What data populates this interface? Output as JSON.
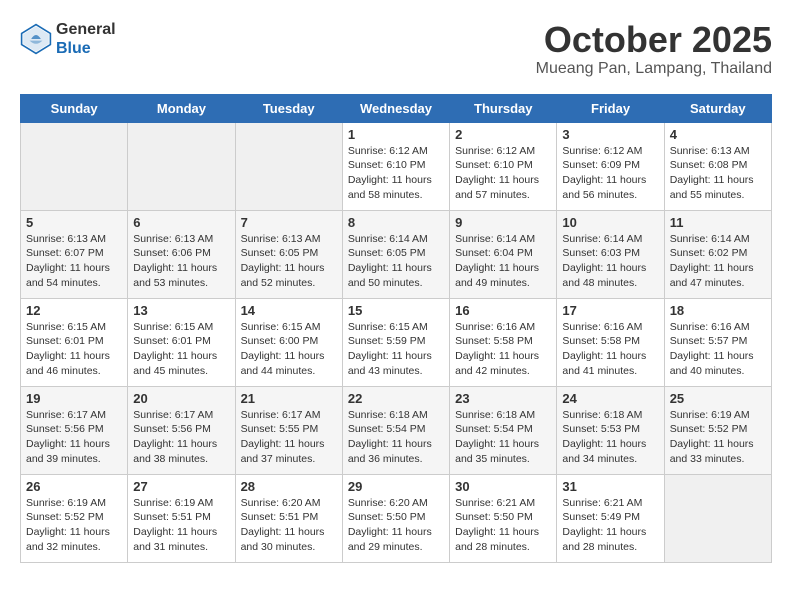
{
  "header": {
    "logo_general": "General",
    "logo_blue": "Blue",
    "month": "October 2025",
    "location": "Mueang Pan, Lampang, Thailand"
  },
  "weekdays": [
    "Sunday",
    "Monday",
    "Tuesday",
    "Wednesday",
    "Thursday",
    "Friday",
    "Saturday"
  ],
  "weeks": [
    [
      {
        "day": "",
        "info": ""
      },
      {
        "day": "",
        "info": ""
      },
      {
        "day": "",
        "info": ""
      },
      {
        "day": "1",
        "info": "Sunrise: 6:12 AM\nSunset: 6:10 PM\nDaylight: 11 hours\nand 58 minutes."
      },
      {
        "day": "2",
        "info": "Sunrise: 6:12 AM\nSunset: 6:10 PM\nDaylight: 11 hours\nand 57 minutes."
      },
      {
        "day": "3",
        "info": "Sunrise: 6:12 AM\nSunset: 6:09 PM\nDaylight: 11 hours\nand 56 minutes."
      },
      {
        "day": "4",
        "info": "Sunrise: 6:13 AM\nSunset: 6:08 PM\nDaylight: 11 hours\nand 55 minutes."
      }
    ],
    [
      {
        "day": "5",
        "info": "Sunrise: 6:13 AM\nSunset: 6:07 PM\nDaylight: 11 hours\nand 54 minutes."
      },
      {
        "day": "6",
        "info": "Sunrise: 6:13 AM\nSunset: 6:06 PM\nDaylight: 11 hours\nand 53 minutes."
      },
      {
        "day": "7",
        "info": "Sunrise: 6:13 AM\nSunset: 6:05 PM\nDaylight: 11 hours\nand 52 minutes."
      },
      {
        "day": "8",
        "info": "Sunrise: 6:14 AM\nSunset: 6:05 PM\nDaylight: 11 hours\nand 50 minutes."
      },
      {
        "day": "9",
        "info": "Sunrise: 6:14 AM\nSunset: 6:04 PM\nDaylight: 11 hours\nand 49 minutes."
      },
      {
        "day": "10",
        "info": "Sunrise: 6:14 AM\nSunset: 6:03 PM\nDaylight: 11 hours\nand 48 minutes."
      },
      {
        "day": "11",
        "info": "Sunrise: 6:14 AM\nSunset: 6:02 PM\nDaylight: 11 hours\nand 47 minutes."
      }
    ],
    [
      {
        "day": "12",
        "info": "Sunrise: 6:15 AM\nSunset: 6:01 PM\nDaylight: 11 hours\nand 46 minutes."
      },
      {
        "day": "13",
        "info": "Sunrise: 6:15 AM\nSunset: 6:01 PM\nDaylight: 11 hours\nand 45 minutes."
      },
      {
        "day": "14",
        "info": "Sunrise: 6:15 AM\nSunset: 6:00 PM\nDaylight: 11 hours\nand 44 minutes."
      },
      {
        "day": "15",
        "info": "Sunrise: 6:15 AM\nSunset: 5:59 PM\nDaylight: 11 hours\nand 43 minutes."
      },
      {
        "day": "16",
        "info": "Sunrise: 6:16 AM\nSunset: 5:58 PM\nDaylight: 11 hours\nand 42 minutes."
      },
      {
        "day": "17",
        "info": "Sunrise: 6:16 AM\nSunset: 5:58 PM\nDaylight: 11 hours\nand 41 minutes."
      },
      {
        "day": "18",
        "info": "Sunrise: 6:16 AM\nSunset: 5:57 PM\nDaylight: 11 hours\nand 40 minutes."
      }
    ],
    [
      {
        "day": "19",
        "info": "Sunrise: 6:17 AM\nSunset: 5:56 PM\nDaylight: 11 hours\nand 39 minutes."
      },
      {
        "day": "20",
        "info": "Sunrise: 6:17 AM\nSunset: 5:56 PM\nDaylight: 11 hours\nand 38 minutes."
      },
      {
        "day": "21",
        "info": "Sunrise: 6:17 AM\nSunset: 5:55 PM\nDaylight: 11 hours\nand 37 minutes."
      },
      {
        "day": "22",
        "info": "Sunrise: 6:18 AM\nSunset: 5:54 PM\nDaylight: 11 hours\nand 36 minutes."
      },
      {
        "day": "23",
        "info": "Sunrise: 6:18 AM\nSunset: 5:54 PM\nDaylight: 11 hours\nand 35 minutes."
      },
      {
        "day": "24",
        "info": "Sunrise: 6:18 AM\nSunset: 5:53 PM\nDaylight: 11 hours\nand 34 minutes."
      },
      {
        "day": "25",
        "info": "Sunrise: 6:19 AM\nSunset: 5:52 PM\nDaylight: 11 hours\nand 33 minutes."
      }
    ],
    [
      {
        "day": "26",
        "info": "Sunrise: 6:19 AM\nSunset: 5:52 PM\nDaylight: 11 hours\nand 32 minutes."
      },
      {
        "day": "27",
        "info": "Sunrise: 6:19 AM\nSunset: 5:51 PM\nDaylight: 11 hours\nand 31 minutes."
      },
      {
        "day": "28",
        "info": "Sunrise: 6:20 AM\nSunset: 5:51 PM\nDaylight: 11 hours\nand 30 minutes."
      },
      {
        "day": "29",
        "info": "Sunrise: 6:20 AM\nSunset: 5:50 PM\nDaylight: 11 hours\nand 29 minutes."
      },
      {
        "day": "30",
        "info": "Sunrise: 6:21 AM\nSunset: 5:50 PM\nDaylight: 11 hours\nand 28 minutes."
      },
      {
        "day": "31",
        "info": "Sunrise: 6:21 AM\nSunset: 5:49 PM\nDaylight: 11 hours\nand 28 minutes."
      },
      {
        "day": "",
        "info": ""
      }
    ]
  ]
}
